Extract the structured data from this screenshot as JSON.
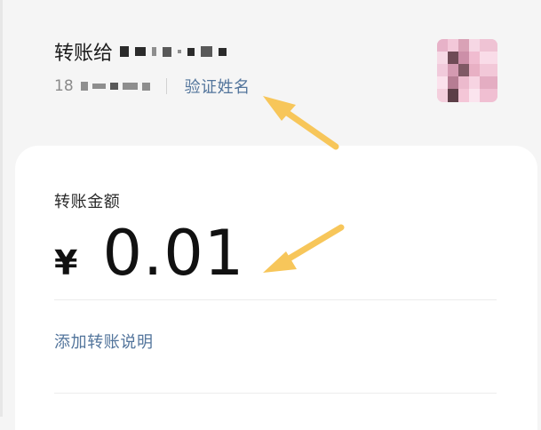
{
  "header": {
    "transfer_to_label": "转账给",
    "phone_prefix": "18",
    "verify_name_label": "验证姓名"
  },
  "amount_card": {
    "label": "转账金额",
    "currency_symbol": "¥",
    "amount_value": "0.01",
    "add_note_label": "添加转账说明"
  },
  "colors": {
    "link": "#53759c",
    "arrow": "#f7c65a",
    "background": "#f5f5f5",
    "card": "#ffffff"
  }
}
